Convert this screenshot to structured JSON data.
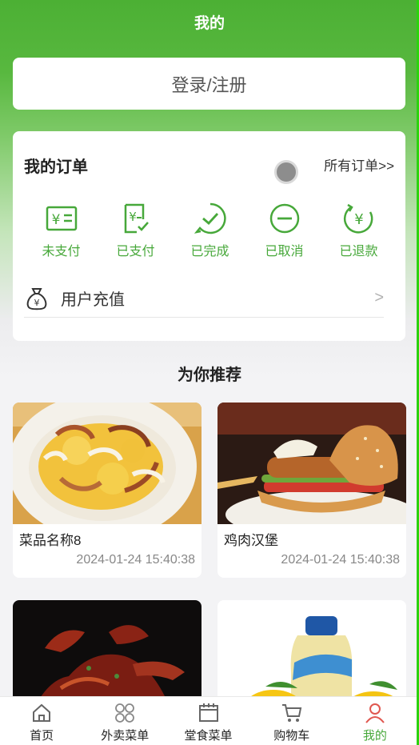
{
  "header": {
    "title": "我的"
  },
  "login": {
    "label": "登录/注册"
  },
  "orders": {
    "title": "我的订单",
    "all_link": "所有订单>>",
    "statuses": [
      {
        "label": "未支付",
        "icon": "unpaid-icon"
      },
      {
        "label": "已支付",
        "icon": "paid-icon"
      },
      {
        "label": "已完成",
        "icon": "completed-icon"
      },
      {
        "label": "已取消",
        "icon": "cancelled-icon"
      },
      {
        "label": "已退款",
        "icon": "refunded-icon"
      }
    ],
    "recharge": {
      "label": "用户充值",
      "arrow": ">"
    }
  },
  "recommend": {
    "title": "为你推荐",
    "items": [
      {
        "name": "菜品名称8",
        "time": "2024-01-24 15:40:38"
      },
      {
        "name": "鸡肉汉堡",
        "time": "2024-01-24 15:40:38"
      },
      {
        "name": "",
        "time": ""
      },
      {
        "name": "",
        "time": ""
      }
    ]
  },
  "tabbar": {
    "items": [
      {
        "label": "首页",
        "icon": "home-icon"
      },
      {
        "label": "外卖菜单",
        "icon": "takeout-menu-icon"
      },
      {
        "label": "堂食菜单",
        "icon": "dine-in-menu-icon"
      },
      {
        "label": "购物车",
        "icon": "cart-icon"
      },
      {
        "label": "我的",
        "icon": "profile-icon",
        "active": true
      }
    ]
  },
  "colors": {
    "primary": "#4cb034",
    "accent_text": "#47a83a",
    "edge": "#2bd30d"
  }
}
